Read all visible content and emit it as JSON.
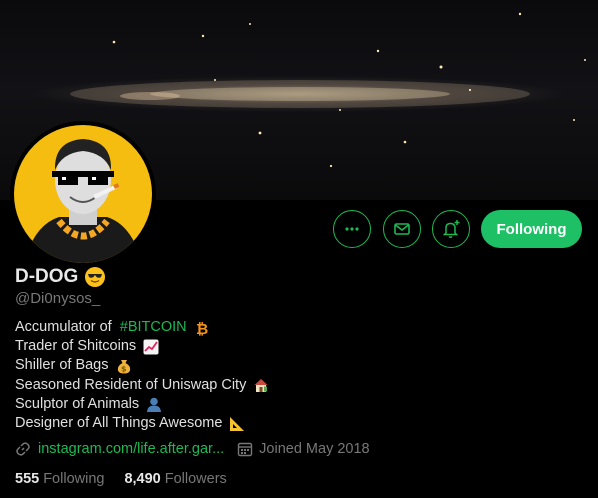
{
  "profile": {
    "display_name": "D-DOG",
    "handle": "@Di0nysos_",
    "name_emoji": "smiling-face-with-sunglasses-emoji"
  },
  "actions": {
    "more_icon": "more-icon",
    "message_icon": "envelope-icon",
    "notify_icon": "bell-plus-icon",
    "follow_label": "Following"
  },
  "bio": {
    "lines": [
      {
        "text": "Accumulator of ",
        "hashtag": "#BITCOIN",
        "emoji": "bitcoin-emoji"
      },
      {
        "text": "Trader of Shitcoins",
        "emoji": "chart-increasing-emoji"
      },
      {
        "text": "Shiller of Bags",
        "emoji": "money-bag-emoji"
      },
      {
        "text": "Seasoned Resident of Uniswap City",
        "emoji": "house-emoji"
      },
      {
        "text": "Sculptor of Animals",
        "emoji": "bust-in-silhouette-emoji"
      },
      {
        "text": "Designer of All Things Awesome",
        "emoji": "triangular-ruler-emoji"
      }
    ]
  },
  "meta": {
    "link_icon": "link-icon",
    "link_text": "instagram.com/life.after.gar...",
    "calendar_icon": "calendar-icon",
    "joined_text": "Joined May 2018"
  },
  "stats": {
    "following_count": "555",
    "following_label": "Following",
    "followers_count": "8,490",
    "followers_label": "Followers"
  },
  "colors": {
    "accent": "#1db954",
    "follow_button": "#1ec066",
    "background": "#000000",
    "avatar_bg": "#f5bd10"
  }
}
